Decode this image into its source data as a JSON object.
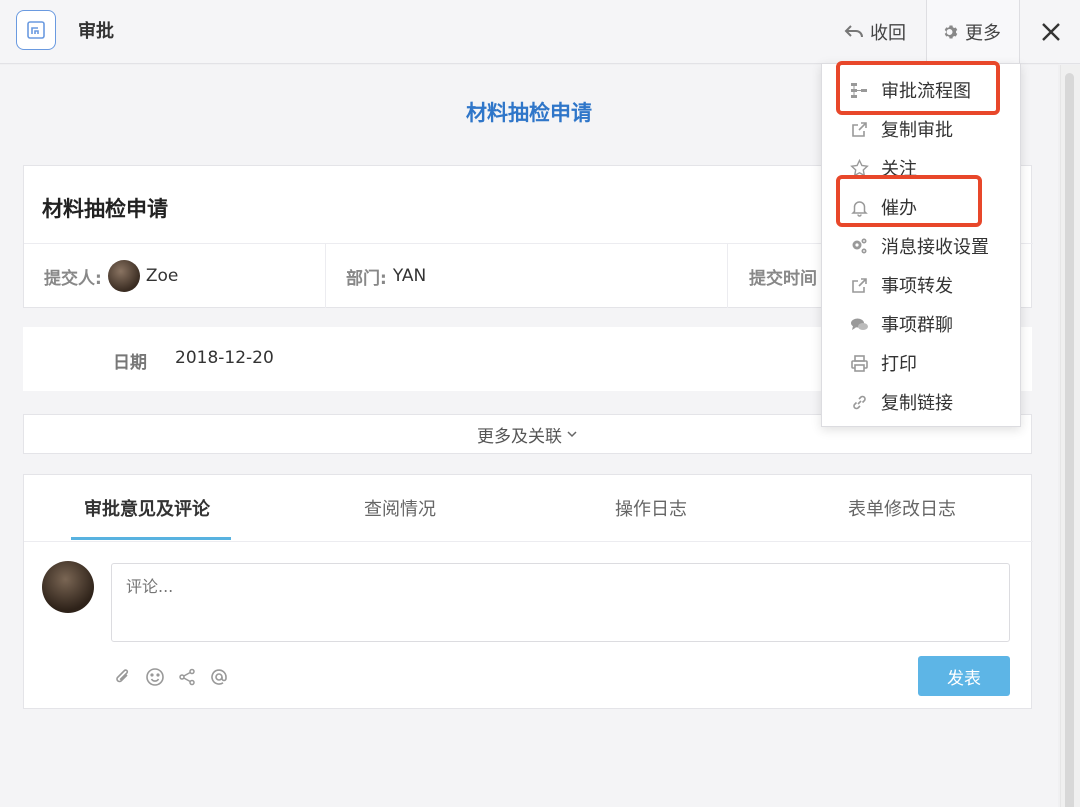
{
  "topbar": {
    "title": "审批",
    "back_label": "收回",
    "more_label": "更多"
  },
  "page": {
    "title": "材料抽检申请"
  },
  "form": {
    "title": "材料抽检申请",
    "submitter_label": "提交人:",
    "submitter_name": "Zoe",
    "dept_label": "部门:",
    "dept_value": "YAN",
    "time_label": "提交时间",
    "date_label": "日期",
    "date_value": "2018-12-20"
  },
  "more_related": "更多及关联",
  "tabs": [
    {
      "label": "审批意见及评论",
      "active": true
    },
    {
      "label": "查阅情况",
      "active": false
    },
    {
      "label": "操作日志",
      "active": false
    },
    {
      "label": "表单修改日志",
      "active": false
    }
  ],
  "comment": {
    "placeholder": "评论...",
    "publish_label": "发表"
  },
  "menu": {
    "items": [
      {
        "label": "审批流程图",
        "icon": "flowchart-icon"
      },
      {
        "label": "复制审批",
        "icon": "copy-share-icon"
      },
      {
        "label": "关注",
        "icon": "star-icon"
      },
      {
        "label": "催办",
        "icon": "bell-icon"
      },
      {
        "label": "消息接收设置",
        "icon": "gears-icon"
      },
      {
        "label": "事项转发",
        "icon": "forward-icon"
      },
      {
        "label": "事项群聊",
        "icon": "chat-icon"
      },
      {
        "label": "打印",
        "icon": "printer-icon"
      },
      {
        "label": "复制链接",
        "icon": "link-icon"
      }
    ]
  },
  "colors": {
    "accent": "#2f76c9",
    "highlight": "#e8472a",
    "publish_button": "#5db5e6"
  }
}
